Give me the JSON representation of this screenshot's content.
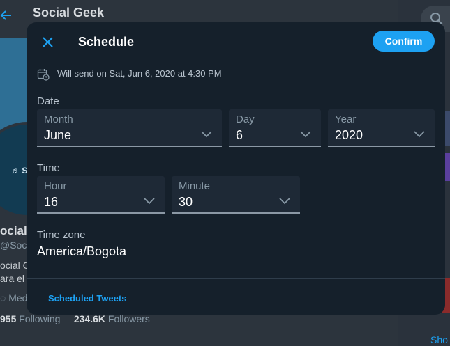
{
  "background": {
    "profile_title": "Social Geek",
    "avatar_text": "♬ S",
    "name_fragment": "ocial",
    "handle_fragment": "@Social",
    "bio_line1": "ocial G",
    "bio_line2": "ara el",
    "meta_fragment": "◌ Med",
    "following_count": "955",
    "following_label": "Following",
    "followers_count": "234.6K",
    "followers_label": "Followers",
    "show_more_fragment": "Sho"
  },
  "modal": {
    "title": "Schedule",
    "confirm_label": "Confirm",
    "schedule_summary": "Will send on Sat, Jun 6, 2020 at 4:30 PM",
    "date_section_label": "Date",
    "month": {
      "label": "Month",
      "value": "June"
    },
    "day": {
      "label": "Day",
      "value": "6"
    },
    "year": {
      "label": "Year",
      "value": "2020"
    },
    "time_section_label": "Time",
    "hour": {
      "label": "Hour",
      "value": "16"
    },
    "minute": {
      "label": "Minute",
      "value": "30"
    },
    "timezone_label": "Time zone",
    "timezone_value": "America/Bogota",
    "scheduled_tweets_link": "Scheduled Tweets"
  },
  "colors": {
    "accent": "#1da1f2",
    "modal_bg": "#15202b",
    "field_bg": "#1e2936"
  },
  "icons": [
    "close-icon",
    "calendar-clock-icon",
    "chevron-down-icon",
    "back-arrow-icon",
    "search-icon"
  ]
}
